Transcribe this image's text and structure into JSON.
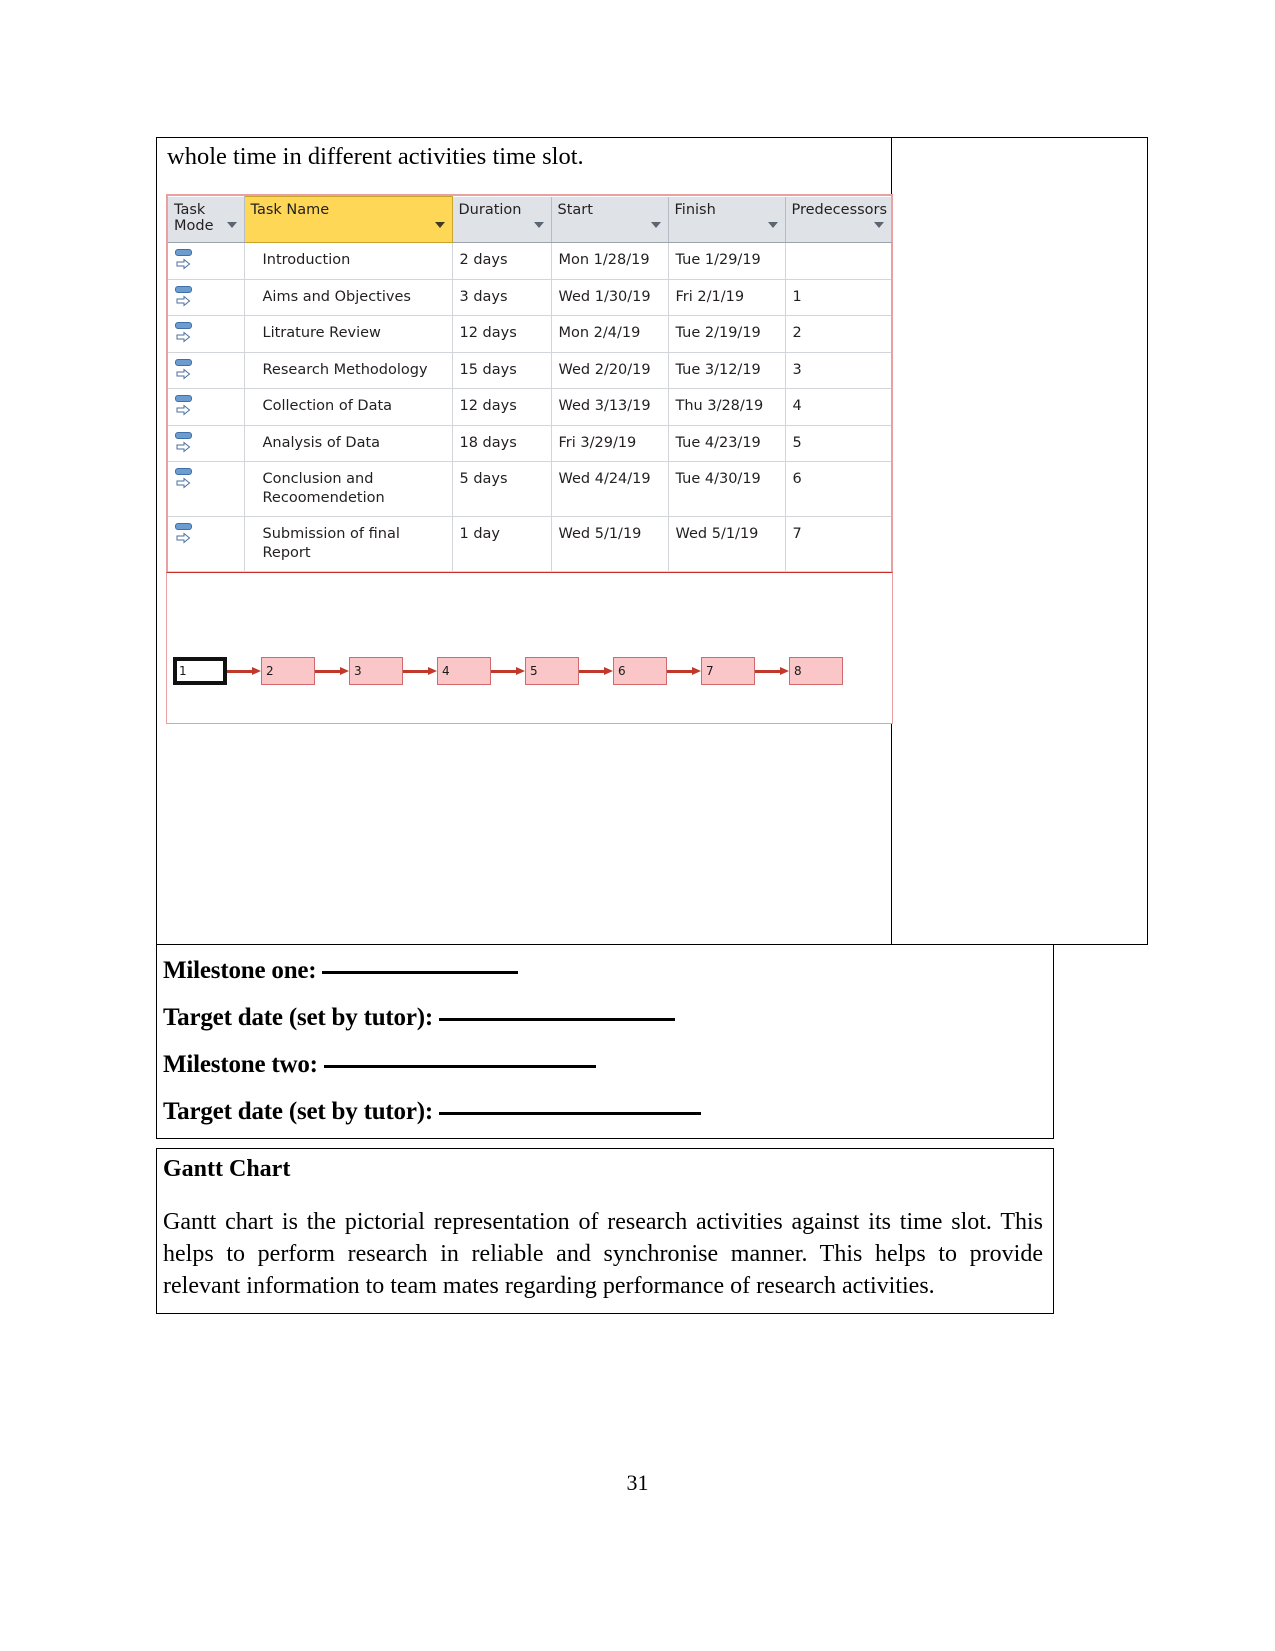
{
  "page": {
    "number": "31",
    "intro_text": "whole time in different activities time slot."
  },
  "project_table": {
    "columns": [
      {
        "label": "Task Mode",
        "has_filter": true,
        "highlighted": false
      },
      {
        "label": "Task Name",
        "has_filter": true,
        "highlighted": true
      },
      {
        "label": "Duration",
        "has_filter": true,
        "highlighted": false
      },
      {
        "label": "Start",
        "has_filter": true,
        "highlighted": false
      },
      {
        "label": "Finish",
        "has_filter": true,
        "highlighted": false
      },
      {
        "label": "Predecessors",
        "has_filter": true,
        "highlighted": false
      }
    ],
    "rows": [
      {
        "mode_icon": "auto-scheduled-icon",
        "name": "Introduction",
        "duration": "2 days",
        "start": "Mon 1/28/19",
        "finish": "Tue 1/29/19",
        "predecessors": ""
      },
      {
        "mode_icon": "auto-scheduled-icon",
        "name": "Aims and Objectives",
        "duration": "3 days",
        "start": "Wed 1/30/19",
        "finish": "Fri 2/1/19",
        "predecessors": "1"
      },
      {
        "mode_icon": "auto-scheduled-icon",
        "name": "Litrature Review",
        "duration": "12 days",
        "start": "Mon 2/4/19",
        "finish": "Tue 2/19/19",
        "predecessors": "2"
      },
      {
        "mode_icon": "auto-scheduled-icon",
        "name": "Research Methodology",
        "duration": "15 days",
        "start": "Wed 2/20/19",
        "finish": "Tue 3/12/19",
        "predecessors": "3"
      },
      {
        "mode_icon": "auto-scheduled-icon",
        "name": "Collection of Data",
        "duration": "12 days",
        "start": "Wed 3/13/19",
        "finish": "Thu 3/28/19",
        "predecessors": "4"
      },
      {
        "mode_icon": "auto-scheduled-icon",
        "name": "Analysis of Data",
        "duration": "18 days",
        "start": "Fri 3/29/19",
        "finish": "Tue 4/23/19",
        "predecessors": "5"
      },
      {
        "mode_icon": "auto-scheduled-icon",
        "name": "Conclusion and Recoomendetion",
        "duration": "5 days",
        "start": "Wed 4/24/19",
        "finish": "Tue 4/30/19",
        "predecessors": "6"
      },
      {
        "mode_icon": "auto-scheduled-icon",
        "name": "Submission of final Report",
        "duration": "1 day",
        "start": "Wed 5/1/19",
        "finish": "Wed 5/1/19",
        "predecessors": "7"
      }
    ]
  },
  "network_diagram": {
    "nodes": [
      "1",
      "2",
      "3",
      "4",
      "5",
      "6",
      "7",
      "8"
    ],
    "selected_node": "1",
    "node_fill": "#fac6c8",
    "arrow_color": "#c0392b"
  },
  "milestones": [
    {
      "label": "Milestone one:",
      "rule_width": 196
    },
    {
      "label": "Target date (set by tutor):",
      "rule_width": 236
    },
    {
      "label": "Milestone two:",
      "rule_width": 272
    },
    {
      "label": "Target date (set by tutor):",
      "rule_width": 262
    }
  ],
  "gantt_section": {
    "heading": "Gantt Chart",
    "paragraph": "Gantt chart is the pictorial representation of research activities against its time slot. This helps to perform research in reliable and synchronise manner. This helps to provide relevant information to team mates regarding performance of research activities."
  },
  "colors": {
    "header_gray": "#dfe3e8",
    "header_highlight_yellow": "#ffd757",
    "screenshot_border_pink": "#e8a0a0",
    "node_pink": "#fac6c8",
    "arrow_red": "#c0392b"
  }
}
